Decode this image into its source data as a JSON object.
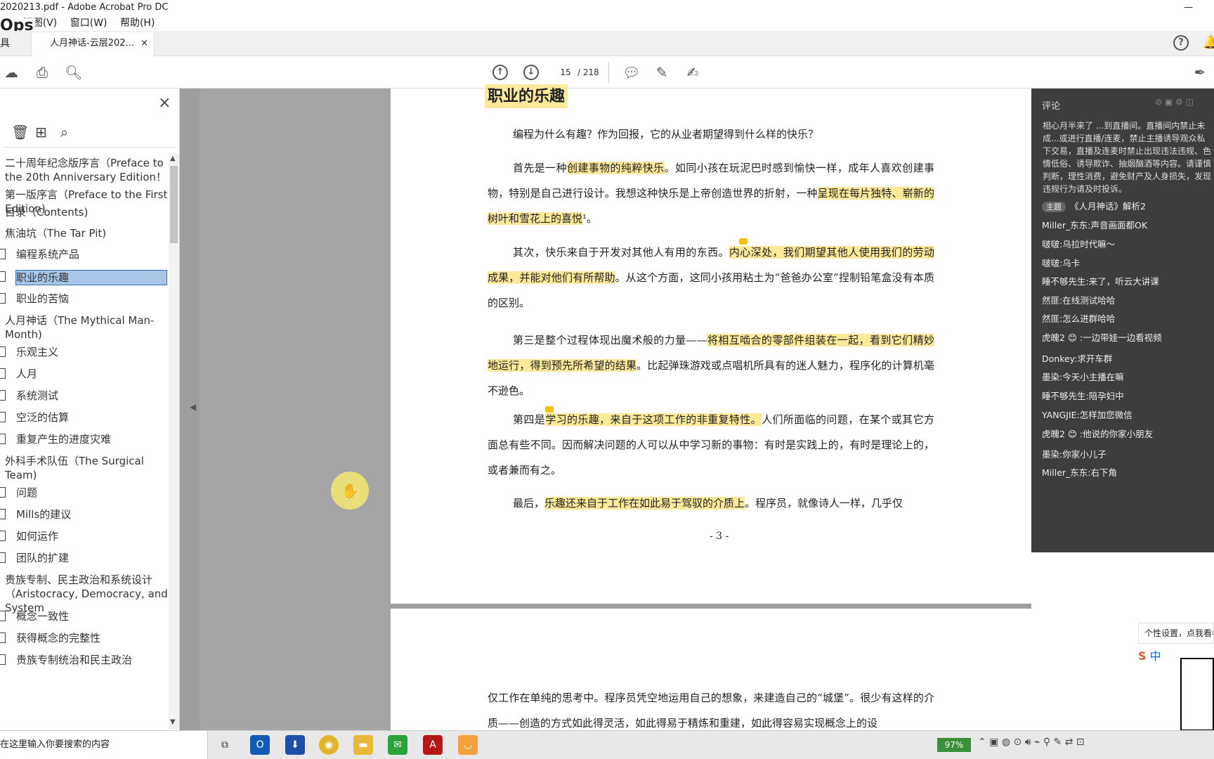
{
  "window": {
    "title": "2020213.pdf - Adobe Acrobat Pro DC",
    "minimize": "—"
  },
  "menu": [
    "视图(V)",
    "窗口(W)",
    "帮助(H)"
  ],
  "menu_prefix": "E)",
  "ops_badge": "Ops",
  "tabs": {
    "tools": "具",
    "doc": "人月神话-云层202...",
    "close": "×"
  },
  "toolbar": {
    "page_current": "15",
    "page_total": "/ 218"
  },
  "bookmarks": {
    "items": [
      {
        "label": "二十周年纪念版序言（Preface to the 20th Anniversary Edition！",
        "level": "top"
      },
      {
        "label": "第一版序言（Preface to the First Edition)",
        "level": "top"
      },
      {
        "label": "目录（Contents)",
        "level": "top"
      },
      {
        "label": "焦油坑（The Tar Pit)",
        "level": "top"
      },
      {
        "label": "编程系统产品",
        "level": "child"
      },
      {
        "label": "职业的乐趣",
        "level": "child",
        "selected": true
      },
      {
        "label": "职业的苦恼",
        "level": "child"
      },
      {
        "label": "人月神话（The Mythical Man-Month)",
        "level": "top"
      },
      {
        "label": "乐观主义",
        "level": "child"
      },
      {
        "label": "人月",
        "level": "child"
      },
      {
        "label": "系统测试",
        "level": "child"
      },
      {
        "label": "空泛的估算",
        "level": "child"
      },
      {
        "label": "重复产生的进度灾难",
        "level": "child"
      },
      {
        "label": "外科手术队伍（The Surgical Team)",
        "level": "top"
      },
      {
        "label": "问题",
        "level": "child"
      },
      {
        "label": "Mills的建议",
        "level": "child"
      },
      {
        "label": "如何运作",
        "level": "child"
      },
      {
        "label": "团队的扩建",
        "level": "child"
      },
      {
        "label": "贵族专制、民主政治和系统设计（Aristocracy, Democracy, and System",
        "level": "top"
      },
      {
        "label": "概念一致性",
        "level": "child"
      },
      {
        "label": "获得概念的完整性",
        "level": "child"
      },
      {
        "label": "贵族专制统治和民主政治",
        "level": "child"
      }
    ]
  },
  "document": {
    "heading": "职业的乐趣",
    "p1": "编程为什么有趣？作为回报，它的从业者期望得到什么样的快乐？",
    "p2a": "首先是一种",
    "p2b": "创建事物的纯粹快乐",
    "p2c": "。如同小孩在玩泥巴时感到愉快一样，成年人喜欢创建事物，特别是自己进行设计。我想这种快乐是上帝创造世界的折射，一种",
    "p2d": "呈现在每片独特、崭新的树叶和雪花上的喜悦",
    "p2e": "¹。",
    "p3a": "其次，快乐来自于开发对其他人有用的东西。",
    "p3b": "内心深处，我们期望其他人使用我们的劳动成果，并能对他们有所帮助",
    "p3c": "。从这个方面，这同小孩用粘土为“爸爸办公室”捏制铅笔盒没有本质的区别。",
    "p4a": "第三是整个过程体现出魔术般的力量——",
    "p4b": "将相互啮合的零部件组装在一起，看到它们精妙地运行，得到预先所希望的结果",
    "p4c": "。比起弹珠游戏或点唱机所具有的迷人魅力，程序化的计算机毫不逊色。",
    "p5a": "第四是",
    "p5b": "学习的乐趣，来自于这项工作的非重复特性。",
    "p5c": "人们所面临的问题，在某个或其它方面总有些不同。因而解决问题的人可以从中学习新的事物：有时是实践上的，有时是理论上的，或者兼而有之。",
    "p6a": "最后，",
    "p6b": "乐趣还来自于工作在如此易于驾驭的介质上",
    "p6c": "。程序员，就像诗人一样，几乎仅",
    "page_number": "- 3 -",
    "p7": "仅工作在单纯的思考中。程序员凭空地运用自己的想象，来建造自己的“城堡”。很少有这样的介质——创造的方式如此得灵活，如此得易于精炼和重建，如此得容易实现概念上的设"
  },
  "comments": {
    "title": "评论",
    "notice": "相心月半来了 ...到直播间。直播间内禁止未成...或进行直播/连麦，禁止主播诱导观众私下交易，直播及连麦时禁止出现违法违规、色情低俗、诱导欺诈、抽烟酗酒等内容。请谨慎判断，理性消费，避免财产及人身损失，发现违规行为请及时投诉。",
    "topic_tag": "主题",
    "topic": "《人月神话》解析2",
    "messages": [
      "Miller_东东:声音画面都OK",
      "啵啵:乌拉时代嘛～",
      "啵啵:乌卡",
      "睡不够先生:来了，听云大讲课",
      "然匪:在线测试哈哈",
      "然匪:怎么进群哈哈",
      "虎魄2 😊 :一边带娃一边看视频",
      "Donkey:求开车群",
      "墨染:今天小主播在嘛",
      "睡不够先生:陪孕妇中",
      "YANGJIE:怎样加您微信",
      "虎魄2 😊 :他说的你家小朋友",
      "墨染:你家小儿子",
      "Miller_东东:右下角"
    ]
  },
  "popups": {
    "tip": "个性设置，点我看看",
    "ime": "中"
  },
  "taskbar": {
    "search_placeholder": "在这里输入你要搜索的内容",
    "battery": "97%"
  },
  "colors": {
    "highlight": "#fde99a",
    "comment_bg": "#3d3d3d",
    "doc_bg": "#9e9e9e"
  }
}
